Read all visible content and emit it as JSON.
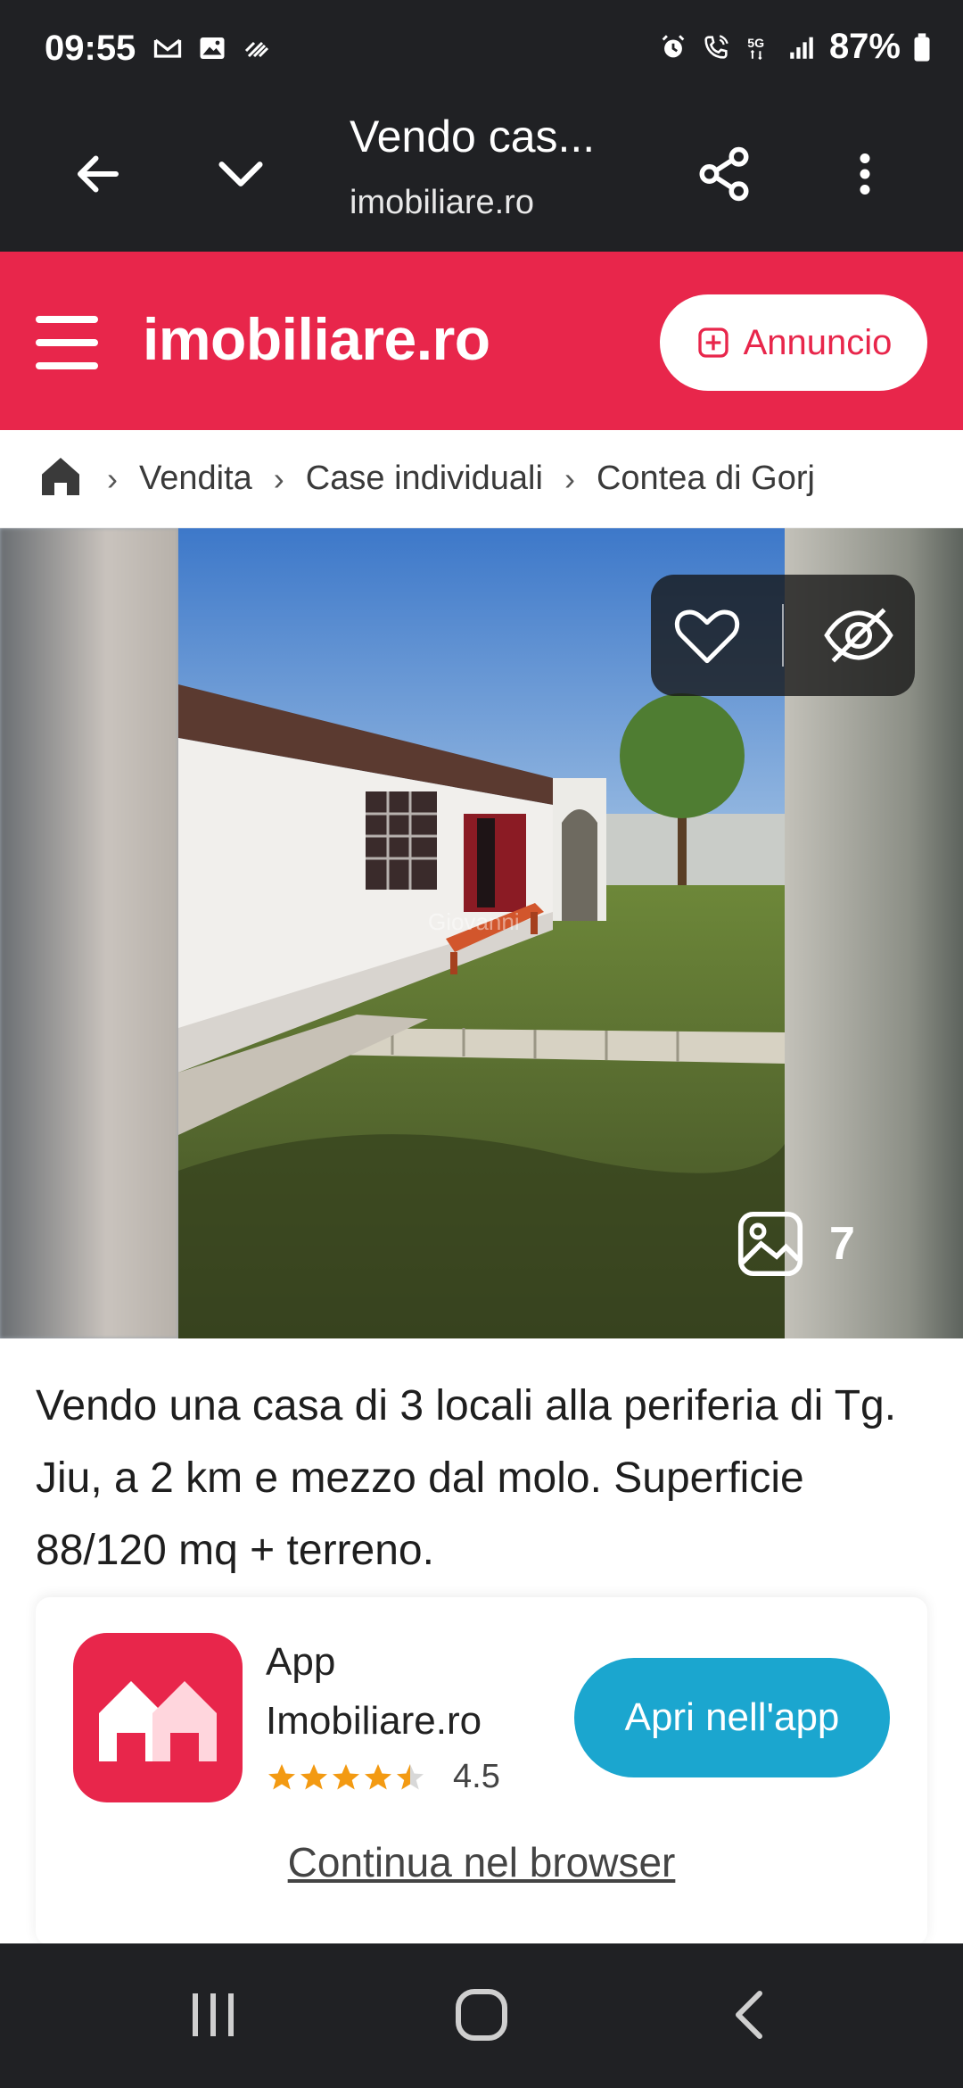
{
  "status_bar": {
    "time": "09:55",
    "battery": "87%",
    "network": "5G"
  },
  "browser": {
    "page_title": "Vendo cas...",
    "url": "imobiliare.ro"
  },
  "site": {
    "logo_text": "imobiliare.ro",
    "brand_color": "#e8264b",
    "annuncio_label": "Annuncio"
  },
  "breadcrumb": {
    "items": [
      "Vendita",
      "Case individuali",
      "Contea di Gorj"
    ]
  },
  "gallery": {
    "photo_count": "7",
    "watermark": "Giovanni"
  },
  "listing": {
    "description": "Vendo una casa di 3 locali alla periferia di Tg. Jiu, a 2 km e mezzo dal molo. Superficie 88/120 mq + terreno."
  },
  "app_banner": {
    "app_name": "App Imobiliare.ro",
    "rating": "4.5",
    "rating_value": 4.5,
    "open_app_label": "Apri nell'app",
    "continue_browser_label": "Continua nel browser",
    "accent_color": "#1ba6cf"
  }
}
